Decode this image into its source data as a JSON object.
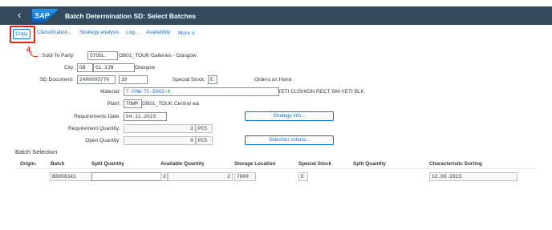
{
  "shell": {
    "back_glyph": "‹",
    "logo_text": "SAP",
    "title": "Batch Determination SD: Select Batches"
  },
  "toolbar": {
    "copy": "Copy",
    "classification": "Classification...",
    "strategy_analysis": "Strategy analysis",
    "log": "Log...",
    "availability": "Availability",
    "more": "More ∨"
  },
  "annotation": {
    "step": "4"
  },
  "header": {
    "sold_to_party": {
      "label": "Sold-To Party:",
      "value": "STOGL",
      "text": "GB01_TOUK Galleries - Glasgow"
    },
    "city": {
      "label": "City:",
      "country": "GB",
      "postal": "G1 3JN",
      "text": "Glasgow"
    },
    "sd_document": {
      "label": "SD Document:",
      "value": "2400005770",
      "item": "30"
    },
    "special_stock": {
      "label": "Special Stock:",
      "value": "E",
      "text": "Orders on Hand"
    },
    "material": {
      "label": "Material:",
      "value": "T-CHW-TC-D002-K",
      "text": "YETI CUSHION RECT SM-YETI BLK"
    },
    "plant": {
      "label": "Plant:",
      "value": "TOWM",
      "text": "GB01_TOUK Central wa"
    },
    "requirements_date": {
      "label": "Requirements Date:",
      "value": "04.12.2023"
    },
    "requirement_quantity": {
      "label": "Requirement Quantity:",
      "value": "2",
      "unit": "PCS"
    },
    "open_quantity": {
      "label": "Open Quantity:",
      "value": "0",
      "unit": "PCS"
    }
  },
  "buttons": {
    "strategy_info": "Strategy info...",
    "selection_criteria": "Selection criteria..."
  },
  "batch_selection": {
    "title": "Batch Selection",
    "columns": [
      "Origin.",
      "Batch",
      "Split Quantity",
      "Available Quantity",
      "Storage Location",
      "Special Stock",
      "Split Quantity",
      "Characteristic Sorting"
    ],
    "rows": [
      {
        "origin": "",
        "batch": "B0058341",
        "split_quantity": "",
        "available_quantity": "2",
        "available_quantity2": "2",
        "storage_location": "7000",
        "special_stock": "E",
        "split_quantity2": "",
        "characteristic_sorting": "12.09.2023"
      }
    ]
  },
  "colors": {
    "shell": "#354a5f",
    "link": "#0a6ed1",
    "highlight": "#e2231a"
  }
}
